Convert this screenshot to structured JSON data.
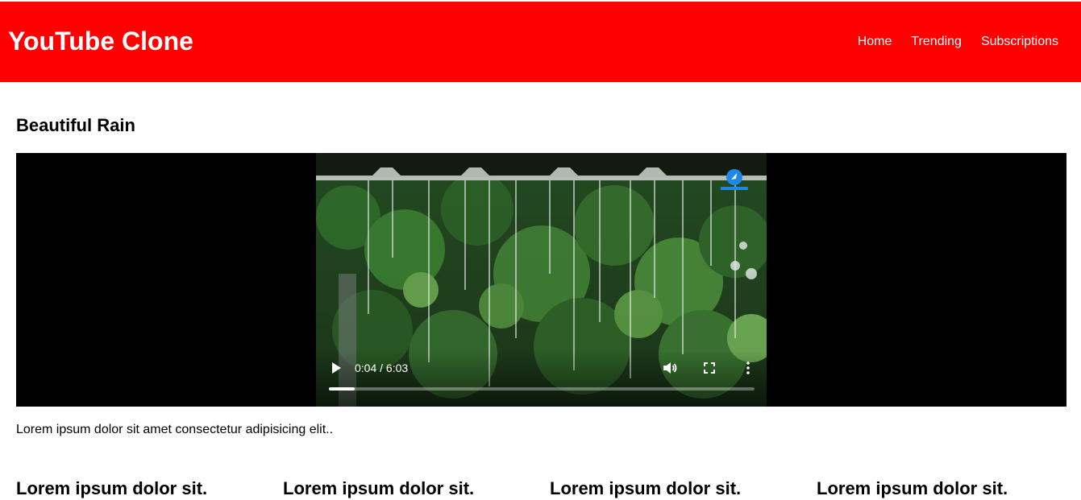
{
  "header": {
    "brand": "YouTube Clone",
    "nav": [
      "Home",
      "Trending",
      "Subscriptions"
    ],
    "background_color": "#ff0000"
  },
  "video": {
    "title": "Beautiful Rain",
    "time_display": "0:04 / 6:03",
    "progress_fraction": 0.011,
    "description": "Lorem ipsum dolor sit amet consectetur adipisicing elit..",
    "controls": [
      "play-icon",
      "volume-icon",
      "fullscreen-icon",
      "more-options-icon"
    ]
  },
  "cards": [
    {
      "title": "Lorem ipsum dolor sit."
    },
    {
      "title": "Lorem ipsum dolor sit."
    },
    {
      "title": "Lorem ipsum dolor sit."
    },
    {
      "title": "Lorem ipsum dolor sit."
    }
  ]
}
